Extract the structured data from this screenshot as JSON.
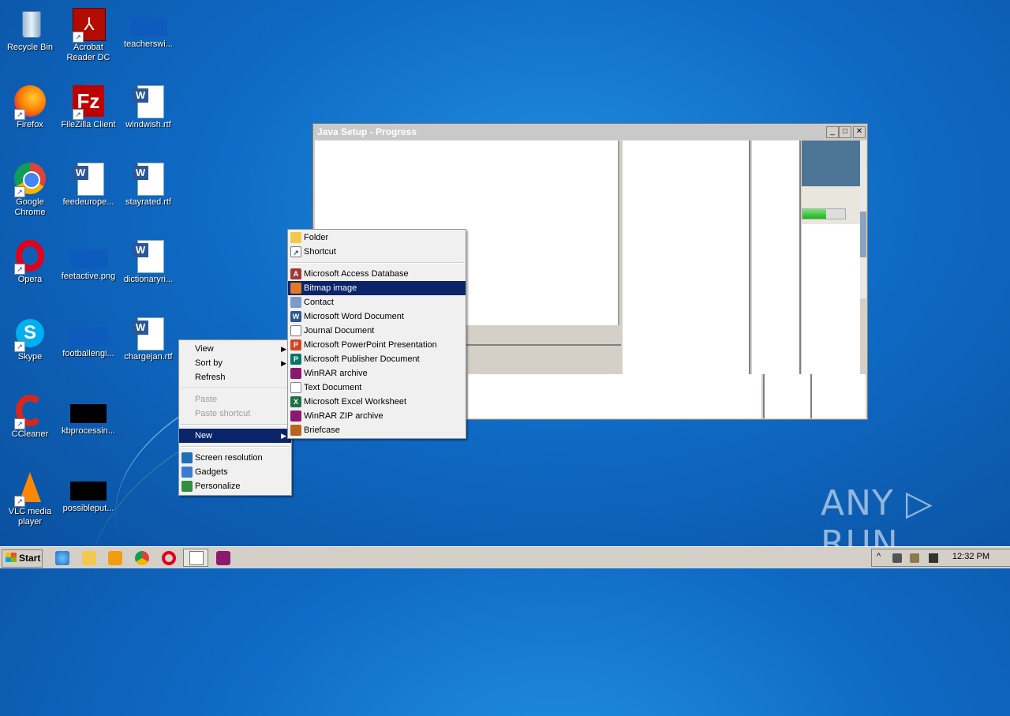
{
  "desktop": {
    "icons": [
      {
        "label": "Recycle Bin"
      },
      {
        "label": "Acrobat Reader DC"
      },
      {
        "label": "teacherswi..."
      },
      {
        "label": "Firefox"
      },
      {
        "label": "FileZilla Client"
      },
      {
        "label": "windwish.rtf"
      },
      {
        "label": "Google Chrome"
      },
      {
        "label": "feedeurope..."
      },
      {
        "label": "stayrated.rtf"
      },
      {
        "label": "Opera"
      },
      {
        "label": "feetactive.png"
      },
      {
        "label": "dictionaryri..."
      },
      {
        "label": "Skype"
      },
      {
        "label": "footballengi..."
      },
      {
        "label": "chargejan.rtf"
      },
      {
        "label": "CCleaner"
      },
      {
        "label": "kbprocessin..."
      },
      {
        "label": "VLC media player"
      },
      {
        "label": "possibleput..."
      }
    ]
  },
  "window": {
    "title": "Java Setup - Progress",
    "minimize_glyph": "_",
    "maximize_glyph": "□",
    "close_glyph": "✕"
  },
  "context_menu": {
    "items": [
      {
        "label": "View",
        "submenu": true
      },
      {
        "label": "Sort by",
        "submenu": true
      },
      {
        "label": "Refresh"
      },
      {
        "label": "Paste",
        "disabled": true
      },
      {
        "label": "Paste shortcut",
        "disabled": true
      },
      {
        "label": "New",
        "submenu": true,
        "highlighted": true
      },
      {
        "label": "Screen resolution"
      },
      {
        "label": "Gadgets"
      },
      {
        "label": "Personalize"
      }
    ],
    "submenu_glyph": "▶"
  },
  "new_submenu": {
    "items": [
      {
        "label": "Folder",
        "icon": "folder-icon"
      },
      {
        "label": "Shortcut",
        "icon": "shortcut-icon"
      },
      {
        "label": "Microsoft Access Database",
        "icon": "access-icon"
      },
      {
        "label": "Bitmap image",
        "icon": "bitmap-icon",
        "highlighted": true
      },
      {
        "label": "Contact",
        "icon": "contact-icon"
      },
      {
        "label": "Microsoft Word Document",
        "icon": "word-icon"
      },
      {
        "label": "Journal Document",
        "icon": "journal-icon"
      },
      {
        "label": "Microsoft PowerPoint Presentation",
        "icon": "powerpoint-icon"
      },
      {
        "label": "Microsoft Publisher Document",
        "icon": "publisher-icon"
      },
      {
        "label": "WinRAR archive",
        "icon": "winrar-icon"
      },
      {
        "label": "Text Document",
        "icon": "text-document-icon"
      },
      {
        "label": "Microsoft Excel Worksheet",
        "icon": "excel-icon"
      },
      {
        "label": "WinRAR ZIP archive",
        "icon": "winrar-zip-icon"
      },
      {
        "label": "Briefcase",
        "icon": "briefcase-icon"
      }
    ]
  },
  "taskbar": {
    "start_label": "Start",
    "clock": "12:32 PM",
    "tray_expand_glyph": "^"
  },
  "watermark": {
    "text": "ANY ▷ RUN"
  },
  "colors": {
    "highlight": "#0a246a",
    "desktop": "#0f6ac4"
  }
}
